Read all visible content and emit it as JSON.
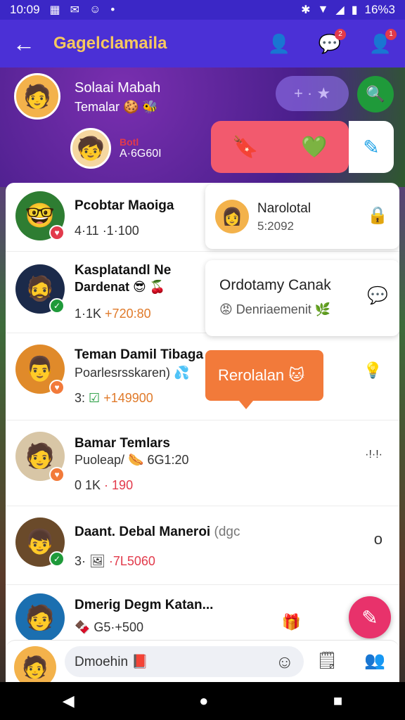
{
  "status": {
    "time": "10:09",
    "left_icons": [
      "sim-icon",
      "message-icon",
      "emoji-icon"
    ],
    "dot": "•",
    "battery": "16%3"
  },
  "appbar": {
    "title": "Gagelclamaila",
    "back_glyph": "←",
    "profile_glyph": "👤",
    "chat_glyph": "💬",
    "chat_badge": "2",
    "alert_glyph": "👤",
    "alert_badge": "1"
  },
  "hero": {
    "name": "Solaai Mabah",
    "subtitle": "Temalar 🍪 🐝",
    "tag1": "Botl",
    "tag2": "A·6G60I",
    "pill_icons": "+ · ★",
    "search_glyph": "🔍",
    "action_left": "🔖",
    "action_right": "💚",
    "edit_glyph": "✎"
  },
  "rows": [
    {
      "title": "Pcobtar Maoiga",
      "sub": "",
      "meta": "4·11 ·1·100",
      "right": ""
    },
    {
      "title": "Kasplatandl Ne",
      "sub": "Dardenat 😎 🍒",
      "meta": "1·1K",
      "meta_num": "+720:80",
      "right": ""
    },
    {
      "title": "Teman Damil Tibaga",
      "sub": "Poarlesrsskaren) 💦",
      "meta": "3:",
      "meta_num": "+149900",
      "right": "💡"
    },
    {
      "title": "Bamar Temlars",
      "sub": "Puoleap/ 🌭  6G1:20",
      "meta": "0 1K",
      "meta_num": "· 190",
      "right": "·!·!·"
    },
    {
      "title": "Daant. Debal Maneroi",
      "sub": "(dgc",
      "meta": "3· 🖼",
      "meta_num": "·7L5060",
      "right": "o"
    },
    {
      "title": "Dmerig Degm Katan...",
      "sub": "",
      "meta": "🍫 G5·+500",
      "meta_num": "",
      "right": "🎁"
    }
  ],
  "cards": [
    {
      "title": "Narolotal",
      "sub": "5:2092",
      "icon": "🔒"
    },
    {
      "title": "Ordotamy Canak",
      "sub": "😡 Denriaemenit 🌿",
      "icon": "💬"
    }
  ],
  "tooltip": {
    "text": "Rerolalan 🐱"
  },
  "composer": {
    "placeholder": "Dmoehin 📕",
    "emoji_glyph": "☺",
    "attach_glyph": "🗒",
    "more_glyph": "👥"
  },
  "fab_glyph": "✎",
  "nav": {
    "back": "◀",
    "home": "●",
    "recents": "■"
  },
  "colors": {
    "primary": "#4b30d6",
    "accent": "#f6c85f",
    "badge_green": "#1f9a3a",
    "badge_red": "#e23a4b",
    "orange": "#f27a3a",
    "pink": "#e8326b"
  }
}
